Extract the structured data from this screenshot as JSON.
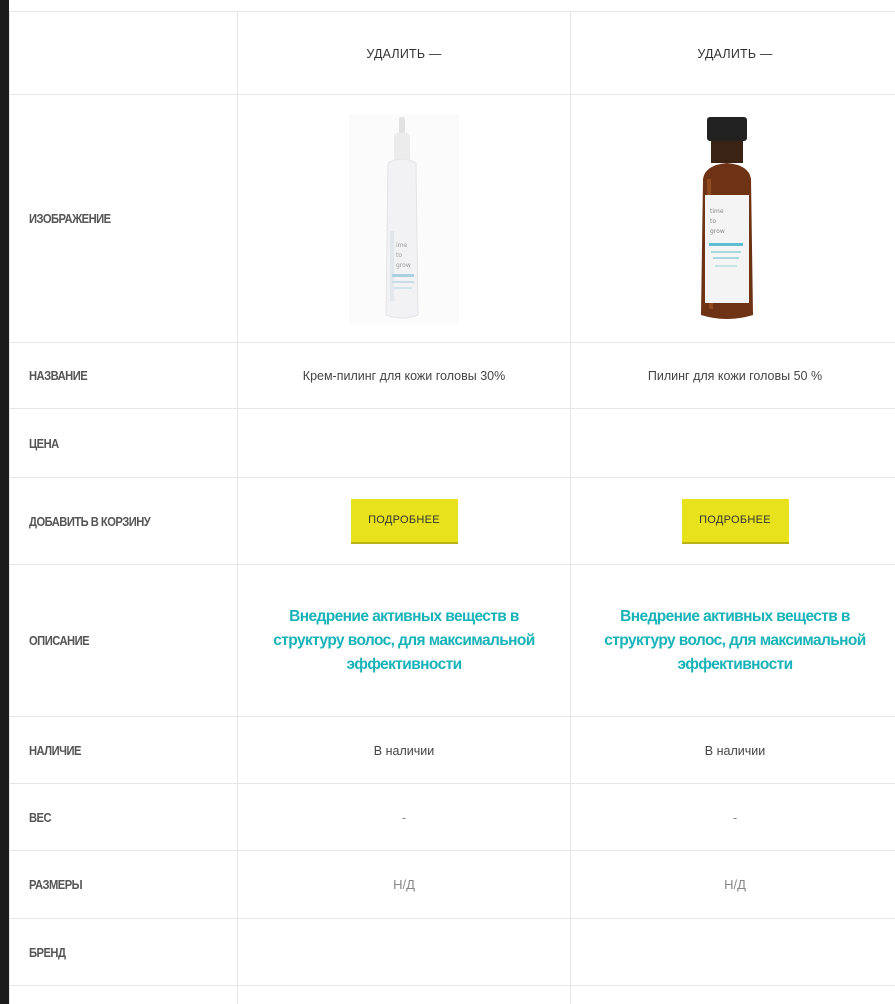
{
  "rows": {
    "image_label": "ИЗОБРАЖЕНИЕ",
    "name_label": "НАЗВАНИЕ",
    "price_label": "ЦЕНА",
    "cart_label": "ДОБАВИТЬ В КОРЗИНУ",
    "desc_label": "ОПИСАНИЕ",
    "avail_label": "НАЛИЧИЕ",
    "weight_label": "ВЕС",
    "size_label": "РАЗМЕРЫ",
    "brand_label": "БРЕНД"
  },
  "products": [
    {
      "remove_label": "УДАЛИТЬ —",
      "image": "white-spray-bottle-product-image",
      "name": "Крем-пилинг для кожи головы 30%",
      "price": "",
      "cart_button": "ПОДРОБНЕЕ",
      "description": "Внедрение активных веществ в структуру волос, для максимальной эффективности",
      "availability": "В наличии",
      "weight": "-",
      "dimensions": "Н/Д",
      "brand": ""
    },
    {
      "remove_label": "УДАЛИТЬ —",
      "image": "amber-dropper-bottle-product-image",
      "name": "Пилинг для кожи головы 50 %",
      "price": "",
      "cart_button": "ПОДРОБНЕЕ",
      "description": "Внедрение активных веществ в структуру волос, для максимальной эффективности",
      "availability": "В наличии",
      "weight": "-",
      "dimensions": "Н/Д",
      "brand": ""
    }
  ],
  "colors": {
    "button_bg": "#e8e21d",
    "description_text": "#17b3b8",
    "border": "#e6e6e6"
  }
}
